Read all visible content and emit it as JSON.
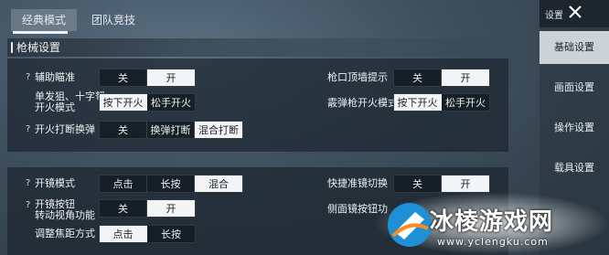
{
  "tabs": [
    {
      "label": "经典模式",
      "active": true
    },
    {
      "label": "团队竞技",
      "active": false
    }
  ],
  "section_title": "枪械设置",
  "panel1": {
    "rows": [
      {
        "help": "?",
        "label": "辅助瞄准",
        "options": [
          "关",
          "开"
        ],
        "selected": 1
      },
      {
        "help": "",
        "label": "单发狙、十字弩\n开火模式",
        "options": [
          "按下开火",
          "松手开火"
        ],
        "selected": 0
      },
      {
        "help": "?",
        "label": "开火打断换弹",
        "options": [
          "关",
          "换弹打断",
          "混合打断"
        ],
        "selected": 2
      },
      {
        "help": "",
        "label": "枪口顶墙提示",
        "options": [
          "关",
          "开"
        ],
        "selected": 1
      },
      {
        "help": "",
        "label": "霰弹枪开火模式",
        "options": [
          "按下开火",
          "松手开火"
        ],
        "selected": 0
      }
    ]
  },
  "panel2": {
    "rows": [
      {
        "help": "?",
        "label": "开镜模式",
        "options": [
          "点击",
          "长按",
          "混合"
        ],
        "selected": 2
      },
      {
        "help": "?",
        "label": "开镜按钮\n转动视角功能",
        "options": [
          "关",
          "开"
        ],
        "selected": 1
      },
      {
        "help": "",
        "label": "调整焦距方式",
        "options": [
          "点击",
          "长按"
        ],
        "selected": 0
      },
      {
        "help": "",
        "label": "快捷准镜切换",
        "options": [
          "关",
          "开"
        ],
        "selected": 1
      },
      {
        "help": "",
        "label": "侧面镜按钮功"
      }
    ]
  },
  "sidebar": {
    "header": "设置",
    "items": [
      {
        "label": "基础设置",
        "active": true
      },
      {
        "label": "画面设置",
        "active": false
      },
      {
        "label": "操作设置",
        "active": false
      },
      {
        "label": "载具设置",
        "active": false
      }
    ]
  },
  "watermark": {
    "text": "冰棱游戏网",
    "url": "www.yclengku.com"
  },
  "colors": {
    "selected_bg": "#f3f4f5",
    "panel_bg": "#1c262f",
    "active_side": "#e1e8ed"
  }
}
